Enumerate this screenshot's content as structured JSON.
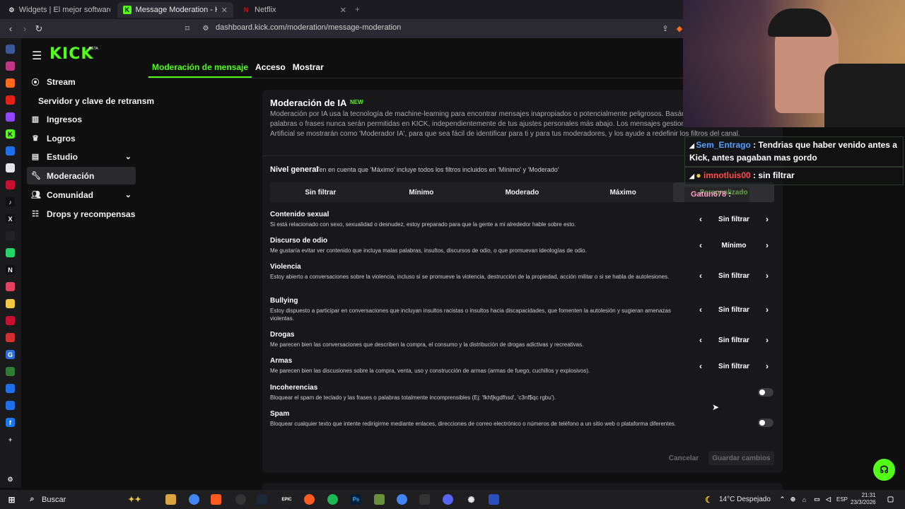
{
  "browser": {
    "tabs": [
      {
        "label": "Widgets | El mejor software para pot",
        "favicon": "gear-icon"
      },
      {
        "label": "Message Moderation - Kick Dash",
        "favicon": "kick-icon"
      },
      {
        "label": "Netflix",
        "favicon": "netflix-icon"
      }
    ],
    "url": "dashboard.kick.com/moderation/message-moderation"
  },
  "sidebar": {
    "logo": "KICK",
    "beta": "BETA",
    "items": [
      {
        "label": "Stream",
        "icon": "broadcast-icon"
      },
      {
        "label": "Servidor y clave de retransm",
        "icon": ""
      },
      {
        "label": "Ingresos",
        "icon": "chart-icon"
      },
      {
        "label": "Logros",
        "icon": "trophy-icon"
      },
      {
        "label": "Estudio",
        "icon": "studio-icon"
      },
      {
        "label": "Moderación",
        "icon": "wrench-icon"
      },
      {
        "label": "Comunidad",
        "icon": "people-icon"
      },
      {
        "label": "Drops y recompensas",
        "icon": "gift-icon"
      }
    ]
  },
  "main": {
    "tabs": [
      "Moderación de mensaje",
      "Acceso",
      "Mostrar"
    ],
    "card": {
      "title": "Moderación de IA",
      "badge": "NEW",
      "description": "Moderación por IA usa la tecnología de machine-learning para encontrar mensajes inapropiados o potencialmente peligrosos. Basán la comunidad. Algunas palabras o frases nunca serán permitidas en KICK, independientemente de tus ajustes personales más abajo. Los mensajes gestionados por la Inteligencia Artificial se mostrarán como 'Moderador IA', para que sea fácil de identificar para ti y para tus moderadores, y los ayude a redefinir los filtros del canal.",
      "level_title": "Nivel general",
      "level_hint": "Ten en cuenta que 'Máximo' incluye todos los filtros incluidos en 'Mínimo' y 'Moderado'",
      "levels": [
        "Sin filtrar",
        "Mínimo",
        "Moderado",
        "Máximo",
        "Personalizado"
      ],
      "categories": [
        {
          "title": "Contenido sexual",
          "desc": "Si está relacionado con sexo, sexualidad o desnudez, estoy preparado para que la gente a mi alrededor hable sobre esto.",
          "value": "Sin filtrar"
        },
        {
          "title": "Discurso de odio",
          "desc": "Me gustaría evitar ver contenido que incluya malas palabras, insultos, discursos de odio, o que promuevan ideologías de odio.",
          "value": "Mínimo"
        },
        {
          "title": "Violencia",
          "desc": "Estoy abierto a conversaciones sobre la violencia, incluso si se promueve la violencia, destrucción de la propiedad, acción militar o si se habla de autolesiones.",
          "value": "Sin filtrar"
        },
        {
          "title": "Bullying",
          "desc": "Estoy dispuesto a participar en conversaciones que incluyan insultos racistas o insultos hacia discapacidades, que fomenten la autolesión y sugieran amenazas violentas.",
          "value": "Sin filtrar"
        },
        {
          "title": "Drogas",
          "desc": "Me parecen bien las conversaciones que describen la compra, el consumo y la distribución de drogas adictivas y recreativas.",
          "value": "Sin filtrar"
        },
        {
          "title": "Armas",
          "desc": "Me parecen bien las discusiones sobre la compra, venta, uso y construcción de armas (armas de fuego, cuchillos y explosivos).",
          "value": "Sin filtrar"
        }
      ],
      "toggles": [
        {
          "title": "Incoherencias",
          "desc": "Bloquear el spam de teclado y las frases o palabras totalmente incomprensibles (Ej: 'fkhfjkgdfhsd', 'c3nf$qc rgbu')."
        },
        {
          "title": "Spam",
          "desc": "Bloquear cualquier texto que intente redirigirme mediante enlaces, direcciones de correo electrónico o números de teléfono a un sitio web o plataforma diferentes."
        }
      ],
      "cancel": "Cancelar",
      "save": "Guardar cambios"
    }
  },
  "chat": [
    {
      "user": "Sem_Entrago",
      "text": ": Tendrias que haber venido antes a Kick, antes pagaban mas gordo"
    },
    {
      "user": "imnotluis00",
      "text": ": sin filtrar"
    },
    {
      "user": "Gatun678",
      "text": ": "
    }
  ],
  "taskbar": {
    "search": "Buscar",
    "weather": "14°C  Despejado",
    "lang": "ESP",
    "time": "21:31",
    "date": "23/3/2026"
  }
}
